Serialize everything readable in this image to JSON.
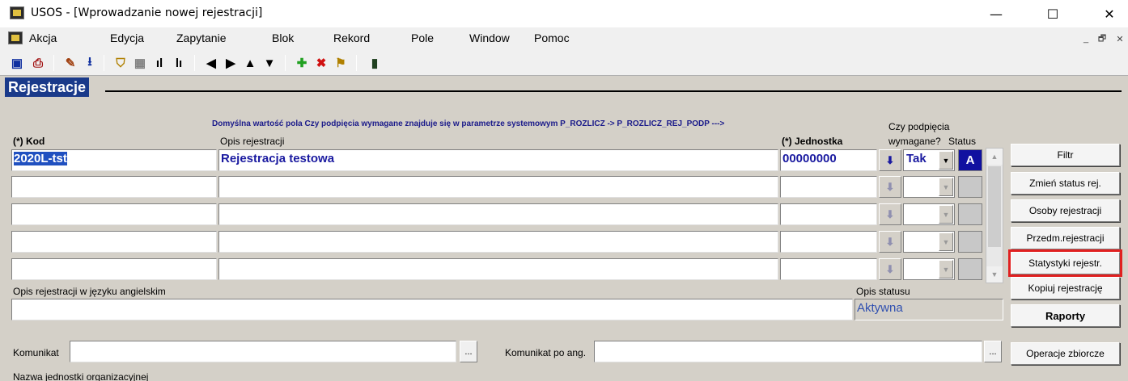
{
  "window": {
    "title": "USOS - [Wprowadzanie nowej rejestracji]",
    "minimize": "—",
    "maximize": "☐",
    "close": "✕"
  },
  "menu": {
    "items": [
      "Akcja",
      "Edycja",
      "Zapytanie",
      "Blok",
      "Rekord",
      "Pole",
      "Window",
      "Pomoc"
    ],
    "mdi_min": "_",
    "mdi_restore": "🗗",
    "mdi_close": "✕"
  },
  "toolbar": [
    "save-icon",
    "print-icon",
    "edit-icon",
    "download-icon",
    "filter-icon",
    "grid-icon",
    "chart-icon",
    "bar-chart-icon",
    "prev-icon",
    "next-icon",
    "up-icon",
    "down-icon",
    "insert-icon",
    "delete-icon",
    "clear-icon",
    "exit-icon"
  ],
  "section": {
    "title": "Rejestracje"
  },
  "note": "Domyślna wartość pola Czy podpięcia wymagane znajduje się w parametrze systemowym  P_ROZLICZ -> P_ROZLICZ_REJ_PODP --->",
  "columns": {
    "kod": "(*) Kod",
    "opis": "Opis rejestracji",
    "jednostka": "(*) Jednostka",
    "podpiecia_1": "Czy podpięcia",
    "podpiecia_2": "wymagane?",
    "status": "Status"
  },
  "rows": [
    {
      "kod": "2020L-tst",
      "opis": "Rejestracja testowa",
      "jednostka": "00000000",
      "podpiecia": "Tak",
      "status": "A"
    },
    {
      "kod": "",
      "opis": "",
      "jednostka": "",
      "podpiecia": "",
      "status": ""
    },
    {
      "kod": "",
      "opis": "",
      "jednostka": "",
      "podpiecia": "",
      "status": ""
    },
    {
      "kod": "",
      "opis": "",
      "jednostka": "",
      "podpiecia": "",
      "status": ""
    },
    {
      "kod": "",
      "opis": "",
      "jednostka": "",
      "podpiecia": "",
      "status": ""
    }
  ],
  "buttons": [
    "Filtr",
    "Zmień status rej.",
    "Osoby rejestracji",
    "Przedm.rejestracji",
    "Statystyki rejestr.",
    "Kopiuj rejestrację",
    "Raporty",
    "Operacje zbiorcze"
  ],
  "opis_ang": {
    "label": "Opis rejestracji w języku angielskim",
    "value": ""
  },
  "opis_statusu": {
    "label": "Opis statusu",
    "value": "Aktywna"
  },
  "komunikat": {
    "label": "Komunikat",
    "value": "",
    "ellipsis": "..."
  },
  "komunikat_ang": {
    "label": "Komunikat po ang.",
    "value": "",
    "ellipsis": "..."
  },
  "footer_label": "Nazwa jednostki organizacyjnej",
  "glyphs": {
    "lov": "⬇",
    "combo_arrow": "▼",
    "scroll_up": "▲",
    "scroll_down": "▼"
  }
}
